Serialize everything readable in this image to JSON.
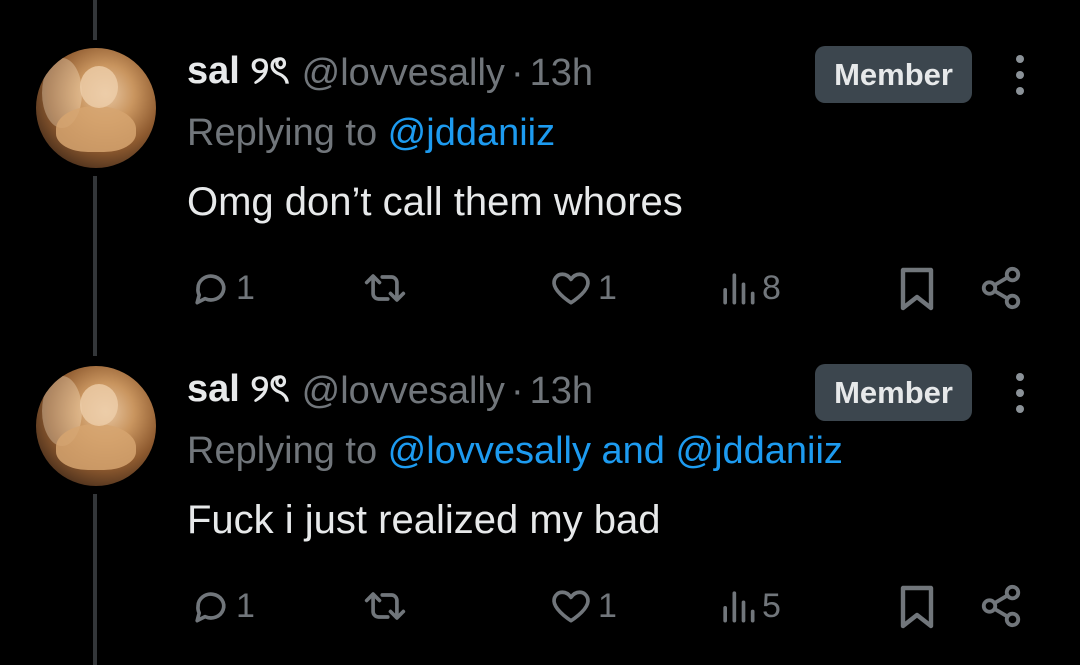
{
  "colors": {
    "background": "#000000",
    "text": "#e7e9ea",
    "muted": "#71767b",
    "link": "#1d9bf0",
    "badge_bg": "#3c464e"
  },
  "tweets": [
    {
      "display_name": "sal ୨ৎ",
      "handle": "@lovvesally",
      "separator": "·",
      "time": "13h",
      "badge": "Member",
      "replying_prefix": "Replying to ",
      "replying_to": "@jddaniiz",
      "text": "Omg don’t call them whores",
      "actions": {
        "reply_icon": "reply-icon",
        "reply_count": "1",
        "repost_icon": "repost-icon",
        "like_icon": "heart-icon",
        "like_count": "1",
        "views_icon": "bar-chart-icon",
        "views_count": "8",
        "bookmark_icon": "bookmark-icon",
        "share_icon": "share-icon"
      }
    },
    {
      "display_name": "sal ୨ৎ",
      "handle": "@lovvesally",
      "separator": "·",
      "time": "13h",
      "badge": "Member",
      "replying_prefix": "Replying to ",
      "replying_to": "@lovvesally and @jddaniiz",
      "text": "Fuck i just realized my bad",
      "actions": {
        "reply_icon": "reply-icon",
        "reply_count": "1",
        "repost_icon": "repost-icon",
        "like_icon": "heart-icon",
        "like_count": "1",
        "views_icon": "bar-chart-icon",
        "views_count": "5",
        "bookmark_icon": "bookmark-icon",
        "share_icon": "share-icon"
      }
    }
  ]
}
